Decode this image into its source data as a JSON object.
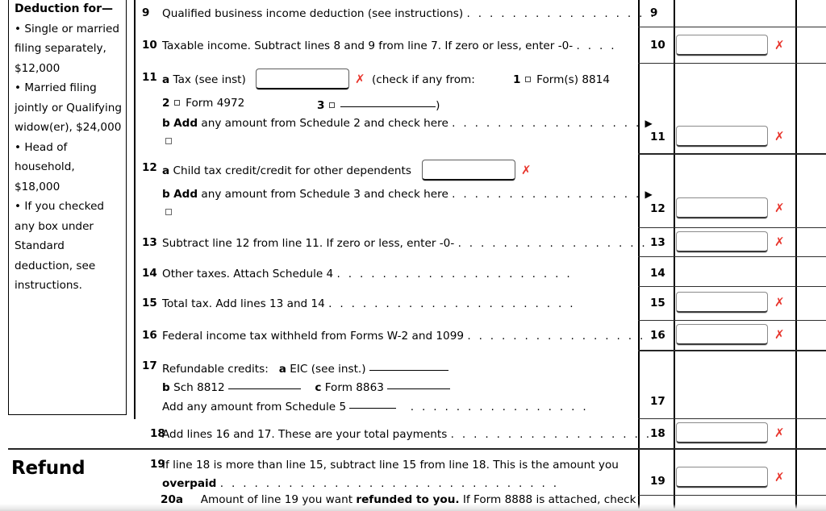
{
  "document": {
    "title": "IRS Form 1040 — lines 9 through 20a"
  },
  "sidebar": {
    "heading": "Deduction for—",
    "lines": [
      "• Single or married",
      "filing separately,",
      "$12,000",
      "• Married filing",
      "jointly or Qualifying",
      "widow(er), $24,000",
      "• Head of",
      "household,",
      "$18,000",
      "• If you checked",
      "any box under",
      "Standard",
      "deduction, see",
      "instructions."
    ]
  },
  "sections": {
    "refund_label": "Refund"
  },
  "lines": [
    {
      "number": "9",
      "text": "Qualified business income deduction (see instructions)",
      "leader": ". . . . . . . . . . . . . . . . .",
      "amount_number": "9",
      "has_entry": false,
      "has_x": false
    },
    {
      "number": "10",
      "text": "Taxable income. Subtract lines 8 and 9 from line 7. If zero or less, enter -0-",
      "leader": ". . . .",
      "amount_number": "10",
      "has_entry": true,
      "has_x": true
    },
    {
      "number": "11",
      "amount_number": "11",
      "has_entry": true,
      "has_x": true,
      "subrows": {
        "a_prefix": "a",
        "a_text": "Tax (see inst)",
        "a_paren_open": "(check if any from:",
        "opt1_num": "1",
        "opt1_label": "Form(s) 8814",
        "opt2_num": "2",
        "opt2_label": "Form 4972",
        "opt3_num": "3",
        "opt3_close": ")",
        "b_prefix": "b",
        "b_bold": "Add",
        "b_text": "any amount from Schedule 2 and check here",
        "b_leader": ". . . . . . . . . . . . . . . . .",
        "b_arrow": "▶"
      }
    },
    {
      "number": "12",
      "amount_number": "12",
      "has_entry": true,
      "has_x": true,
      "subrows": {
        "a_prefix": "a",
        "a_text": "Child tax credit/credit for other dependents",
        "b_prefix": "b",
        "b_bold": "Add",
        "b_text": "any amount from Schedule 3 and check here",
        "b_leader": ". . . . . . . . . . . . . . . . .",
        "b_arrow": "▶"
      }
    },
    {
      "number": "13",
      "text": "Subtract line 12 from line 11. If zero or less, enter -0-",
      "leader": ". . . . . . . . . . . . . . . . .",
      "amount_number": "13",
      "has_entry": true,
      "has_x": true
    },
    {
      "number": "14",
      "text": "Other taxes. Attach Schedule 4",
      "leader": ". . . . . . . . . . . . . . . . . . . . .",
      "amount_number": "14",
      "has_entry": false,
      "has_x": false
    },
    {
      "number": "15",
      "text": "Total tax. Add lines 13 and 14",
      "leader": ". . . . . . . . . . . . . . . . . . . . . .",
      "amount_number": "15",
      "has_entry": true,
      "has_x": true
    },
    {
      "number": "16",
      "text": "Federal income tax withheld from Forms W-2 and 1099",
      "leader": ". . . . . . . . . . . . . . . . .",
      "amount_number": "16",
      "has_entry": true,
      "has_x": true
    },
    {
      "number": "17",
      "amount_number": "17",
      "has_entry": false,
      "has_x": false,
      "subrows": {
        "lead_text": "Refundable credits:",
        "a_prefix": "a",
        "a_text": "EIC (see inst.)",
        "b_prefix": "b",
        "b_text": "Sch 8812",
        "c_prefix": "c",
        "c_text": "Form 8863",
        "sched_text": "Add any amount from Schedule 5",
        "sched_leader": ". . . . . . . . . . . . . . . ."
      }
    },
    {
      "number": "18",
      "text": "Add lines 16 and 17. These are your total payments",
      "leader": ". . . . . . . . . . . . . . . . . .",
      "amount_number": "18",
      "has_entry": true,
      "has_x": true
    },
    {
      "number": "19",
      "text_part1": "If line 18 is more than line 15, subtract line 15 from line 18. This is the amount you",
      "text_bold": "overpaid",
      "leader": ". . . . . . . . . . . . . . . . . . . . . . . . . . . . . .",
      "amount_number": "19",
      "has_entry": true,
      "has_x": true
    }
  ],
  "cutoff_row": {
    "number": "20a",
    "text_part1": "Amount of line 19 you want",
    "text_bold": "refunded to you.",
    "text_part2": "If Form 8888 is attached, check"
  },
  "colors": {
    "x_marker": "#e8352c",
    "rule": "#2e2e2e",
    "entry_border": "#8a8a8a"
  }
}
